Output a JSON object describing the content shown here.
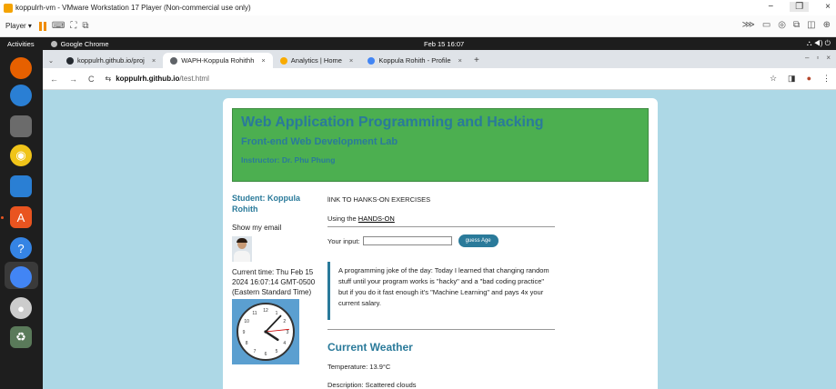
{
  "vm": {
    "title": "koppulrh-vm - VMware Workstation 17 Player (Non-commercial use only)",
    "player_menu": "Player ▾",
    "win_min": "−",
    "win_max": "❐",
    "win_close": "×",
    "toolbar_icons": [
      "send-keys-icon",
      "fullscreen-icon",
      "unity-icon"
    ],
    "tray_icons": [
      "⋙",
      "▭",
      "◎",
      "⧉",
      "◫",
      "⊕"
    ]
  },
  "gnome": {
    "activities": "Activities",
    "app_name": "Google Chrome",
    "clock": "Feb 15  16:07",
    "tray": "⛬ ◀) ⏻"
  },
  "chrome": {
    "tabs": [
      {
        "label": "koppulrh.github.io/proj",
        "fav_color": "#24292f",
        "active": false
      },
      {
        "label": "WAPH-Koppula Rohithh",
        "fav_color": "#5f6368",
        "active": true
      },
      {
        "label": "Analytics | Home",
        "fav_color": "#f9ab00",
        "active": false
      },
      {
        "label": "Koppula Rohith - Profile",
        "fav_color": "#4285f4",
        "active": false
      }
    ],
    "tab_dropdown": "⌄",
    "tab_close": "×",
    "new_tab": "+",
    "nav_back": "←",
    "nav_forward": "→",
    "nav_reload": "C",
    "url_icon": "⇆",
    "url_host": "koppulrh.github.io",
    "url_path": "/test.html",
    "right_icons": {
      "bookmark": "☆",
      "sidepanel": "◨",
      "profile": "●",
      "menu": "⋮"
    }
  },
  "page": {
    "header_title": "Web Application Programming and Hacking",
    "header_subtitle": "Front-end Web Development Lab",
    "header_instructor": "Instructor: Dr. Phu Phung",
    "student": "Student: Koppula Rohith",
    "show_email": "Show my email",
    "current_time": "Current time: Thu Feb 15 2024 16:07:14 GMT-0500 (Eastern Standard Time)",
    "link_title": "lINK TO HANKS-ON EXERCISES",
    "using_prefix": "Using the ",
    "using_link": "HANDS-ON",
    "input_label": "Your input:",
    "input_value": "",
    "guess_button": "guess Age",
    "joke": "A programming joke of the day: Today I learned that changing random stuff until your program works is \"hacky\" and a \"bad coding practice\" but if you do it fast enough it's \"Machine Learning\" and pays 4x your current salary.",
    "weather_title": "Current Weather",
    "temperature": "Temperature: 13.9°C",
    "description": "Description: Scattered clouds",
    "colors": {
      "header_bg": "#4caf50",
      "accent": "#2a7a9a",
      "page_bg": "#add8e6",
      "clock_bg": "#5b9fd0"
    },
    "clock": {
      "hour": 4,
      "minute": 7,
      "second": 14
    }
  },
  "dock": [
    {
      "name": "firefox-icon",
      "glyph": "",
      "color": "#e66000"
    },
    {
      "name": "thunderbird-icon",
      "glyph": "",
      "color": "#2a7fd4"
    },
    {
      "name": "files-icon",
      "glyph": "",
      "color": "#6b6b6b"
    },
    {
      "name": "rhythmbox-icon",
      "glyph": "◉",
      "color": "#f0c419"
    },
    {
      "name": "writer-icon",
      "glyph": "",
      "color": "#2a7fd4"
    },
    {
      "name": "app-center-icon",
      "glyph": "A",
      "color": "#e95420"
    },
    {
      "name": "help-icon",
      "glyph": "?",
      "color": "#3584e4"
    },
    {
      "name": "chrome-icon",
      "glyph": "",
      "color": "#4285f4"
    },
    {
      "name": "dvd-icon",
      "glyph": "●",
      "color": "#cccccc"
    },
    {
      "name": "trash-icon",
      "glyph": "♻",
      "color": "#5a7a5a"
    }
  ]
}
